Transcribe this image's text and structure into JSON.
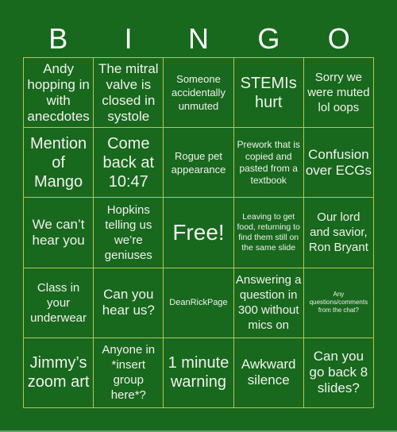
{
  "header": {
    "letters": [
      "B",
      "I",
      "N",
      "G",
      "O"
    ]
  },
  "colors": {
    "background": "#18681e",
    "grid_border": "#b9c64c",
    "text": "#ffffff"
  },
  "cells": [
    "Andy hopping in with anecdotes",
    "The mitral valve is closed in systole",
    "Someone accidentally unmuted",
    "STEMIs hurt",
    "Sorry we were muted lol oops",
    "Mention of Mango",
    "Come back at 10:47",
    "Rogue pet appearance",
    "Prework that is copied and pasted from a textbook",
    "Confusion over ECGs",
    "We can’t hear you",
    "Hopkins telling us we’re geniuses",
    "Free!",
    "Leaving to get food, returning to find them still on the same slide",
    "Our lord and savior, Ron Bryant",
    "Class in your underwear",
    "Can you hear us?",
    "DeanRickPage",
    "Answering a question in 300 without mics on",
    "Any questions/comments from the chat?",
    "Jimmy’s zoom art",
    "Anyone in *insert group here*?",
    "1 minute warning",
    "Awkward silence",
    "Can you go back 8 slides?"
  ]
}
